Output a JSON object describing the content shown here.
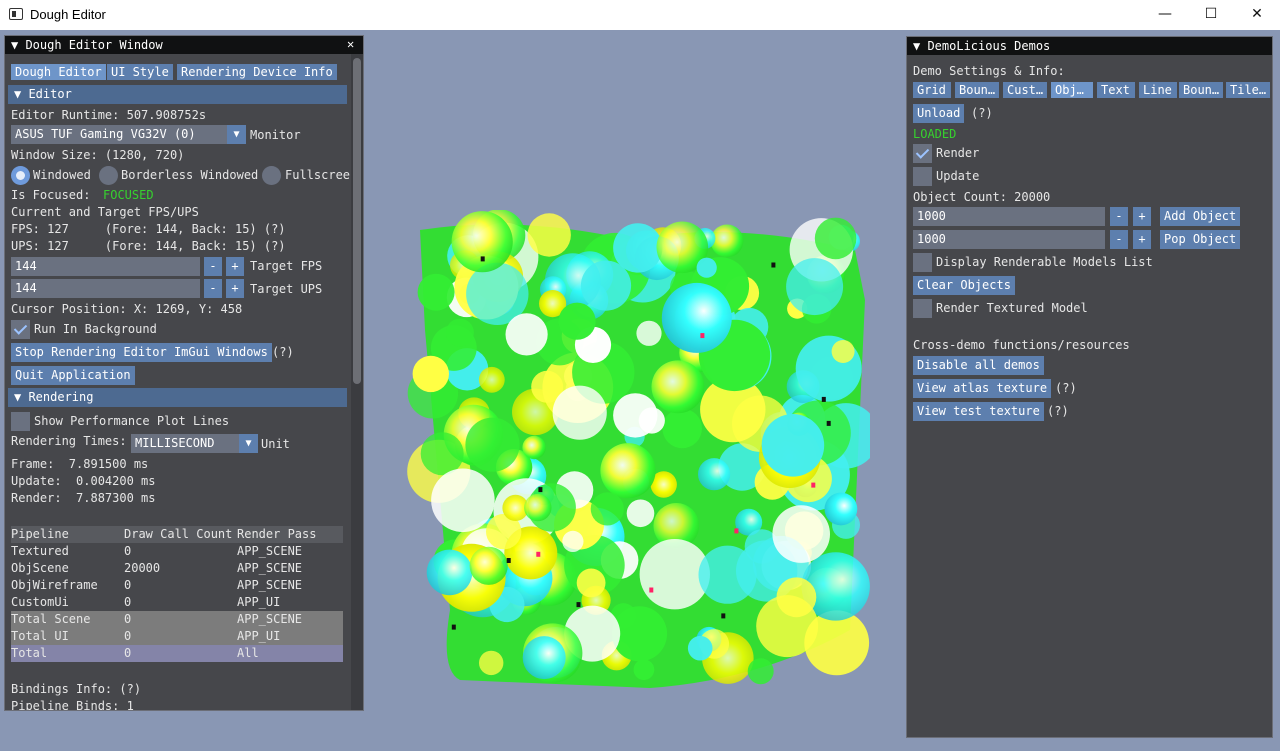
{
  "window": {
    "title": "Dough Editor",
    "minimize": "—",
    "maximize": "☐",
    "close": "✕"
  },
  "left": {
    "title": "Dough Editor Window",
    "close": "✕",
    "tabs": [
      "Dough Editor",
      "UI Style",
      "Rendering Device Info"
    ],
    "editor_header": "Editor",
    "runtime": "Editor Runtime: 507.908752s",
    "monitor_value": "ASUS TUF Gaming VG32V (0)",
    "monitor_label": "Monitor",
    "window_size": "Window Size: (1280, 720)",
    "modes": [
      "Windowed",
      "Borderless Windowed",
      "Fullscree"
    ],
    "focused_label": "Is Focused:",
    "focused_value": "FOCUSED",
    "fps_title": "Current and Target FPS/UPS",
    "fps_line": "FPS: 127     (Fore: 144, Back: 15) (?)",
    "ups_line": "UPS: 127     (Fore: 144, Back: 15) (?)",
    "target_fps_value": "144",
    "target_fps_label": "Target FPS",
    "target_ups_value": "144",
    "target_ups_label": "Target UPS",
    "minus": "-",
    "plus": "+",
    "cursor": "Cursor Position: X: 1269, Y: 458",
    "run_bg": "Run In Background",
    "stop_btn": "Stop Rendering Editor ImGui Windows",
    "help": "(?)",
    "quit_btn": "Quit Application",
    "rendering_header": "Rendering",
    "show_perf": "Show Performance Plot Lines",
    "rt_label": "Rendering Times:",
    "rt_value": "MILLISECOND",
    "rt_unit": "Unit",
    "frame": "Frame:  7.891500 ms",
    "update": "Update:  0.004200 ms",
    "render": "Render:  7.887300 ms",
    "table_headers": [
      "Pipeline",
      "Draw Call Count",
      "Render Pass"
    ],
    "table_rows": [
      [
        "Textured",
        "0",
        "APP_SCENE"
      ],
      [
        "ObjScene",
        "20000",
        "APP_SCENE"
      ],
      [
        "ObjWireframe",
        "0",
        "APP_SCENE"
      ],
      [
        "CustomUi",
        "0",
        "APP_UI"
      ],
      [
        "Total Scene",
        "0",
        "APP_SCENE"
      ],
      [
        "Total UI",
        "0",
        "APP_UI"
      ],
      [
        "Total",
        "0",
        "All"
      ]
    ],
    "bindings": "Bindings Info: (?)",
    "pipeline_binds": "Pipeline Binds: 1"
  },
  "right": {
    "title": "DemoLicious Demos",
    "settings": "Demo Settings & Info:",
    "tabs": [
      "Grid",
      "Boun…",
      "Cust…",
      "Obj…",
      "Text",
      "Line",
      "Boun…",
      "Tile…"
    ],
    "unload": "Unload",
    "help": "(?)",
    "loaded": "LOADED",
    "render": "Render",
    "update": "Update",
    "object_count": "Object Count: 20000",
    "add_value": "1000",
    "pop_value": "1000",
    "minus": "-",
    "plus": "+",
    "add_btn": "Add Object",
    "pop_btn": "Pop Object",
    "display_models": "Display Renderable Models List",
    "clear": "Clear Objects",
    "render_textured": "Render Textured Model",
    "cross": "Cross-demo functions/resources",
    "disable": "Disable all demos",
    "atlas": "View atlas texture",
    "test": "View test texture"
  },
  "colors": {
    "accent": "#5d7fae",
    "header": "#4d6a91",
    "loaded": "#36d22e",
    "panel": "#46474b",
    "viewport": "#8997b4"
  }
}
